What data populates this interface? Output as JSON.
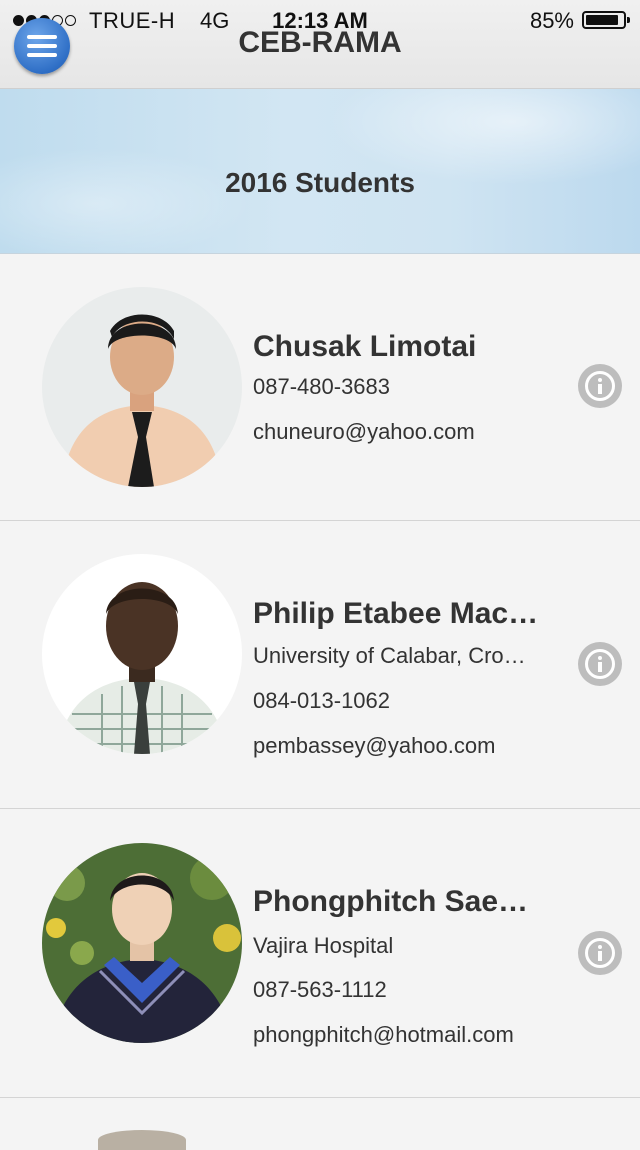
{
  "status_bar": {
    "carrier": "TRUE-H",
    "network": "4G",
    "time": "12:13 AM",
    "battery": "85%"
  },
  "header": {
    "title": "CEB-RAMA",
    "menu_icon": "hamburger-menu-icon"
  },
  "banner": {
    "title": "2016 Students"
  },
  "students": [
    {
      "name": "Chusak Limotai",
      "lines": [
        "087-480-3683",
        "chuneuro@yahoo.com"
      ]
    },
    {
      "name": "Philip Etabee Mac…",
      "lines": [
        "University of Calabar, Cro…",
        "084-013-1062",
        "pembassey@yahoo.com"
      ]
    },
    {
      "name": "Phongphitch Sae…",
      "lines": [
        "Vajira Hospital",
        "087-563-1112",
        "phongphitch@hotmail.com"
      ]
    }
  ],
  "colors": {
    "menu_button": "#2f6fc6",
    "info_icon": "#bdbdbd",
    "banner": "#cfe4f2"
  }
}
